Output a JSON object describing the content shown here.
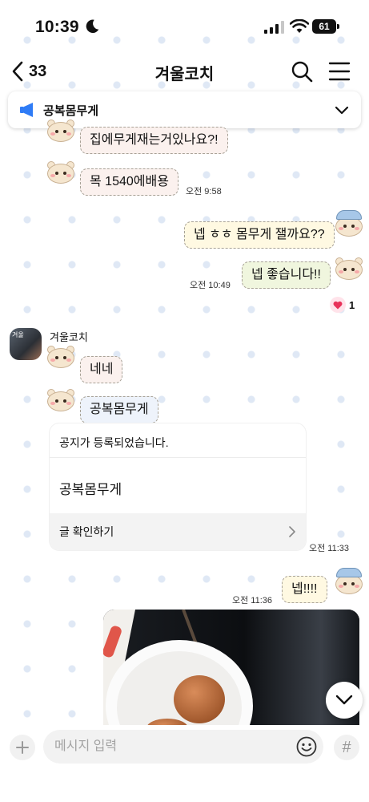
{
  "status": {
    "time": "10:39",
    "battery": "61"
  },
  "header": {
    "back_count": "33",
    "title": "겨울코치"
  },
  "notice_bar": {
    "text": "공복몸무게"
  },
  "messages": {
    "m1": "집에무게재는거있나요?!",
    "m2": "목 1540에배용",
    "m2_time": "오전 9:58",
    "m3": "넵 ㅎㅎ 몸무게 잴까요??",
    "m4": "넵 좋습니다!!",
    "m4_time": "오전 10:49",
    "reaction_count": "1",
    "sender": "겨울코치",
    "avatar_text": "겨울",
    "m5": "네네",
    "m6": "공복몸무게",
    "notice_card": {
      "header": "공지가 등록되었습니다.",
      "title": "공복몸무게",
      "footer": "글 확인하기"
    },
    "m6_time": "오전 11:33",
    "m7": "넵!!!!",
    "m7_time": "오전 11:36"
  },
  "input": {
    "placeholder": "메시지 입력"
  },
  "icons": {
    "back": "chevron-left-icon",
    "search": "search-icon",
    "menu": "hamburger-icon",
    "notice": "megaphone-icon",
    "scroll": "chevron-down-icon",
    "plus": "plus-icon",
    "emoji": "smile-icon",
    "hash": "hash-icon"
  },
  "colors": {
    "notice_icon": "#2f7cf6",
    "heart": "#e8325a"
  }
}
